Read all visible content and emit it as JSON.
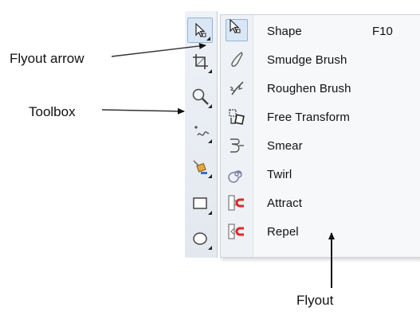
{
  "toolbox": {
    "tools": [
      {
        "icon": "shape-tool-icon",
        "selected": true
      },
      {
        "icon": "crop-tool-icon",
        "selected": false
      },
      {
        "icon": "zoom-tool-icon",
        "selected": false
      },
      {
        "icon": "freehand-tool-icon",
        "selected": false
      },
      {
        "icon": "smart-fill-tool-icon",
        "selected": false
      },
      {
        "icon": "rectangle-tool-icon",
        "selected": false
      },
      {
        "icon": "ellipse-tool-icon",
        "selected": false
      }
    ]
  },
  "flyout": {
    "items": [
      {
        "label": "Shape",
        "shortcut": "F10",
        "icon": "shape-tool-icon",
        "selected": true
      },
      {
        "label": "Smudge Brush",
        "icon": "smudge-brush-icon"
      },
      {
        "label": "Roughen Brush",
        "icon": "roughen-brush-icon"
      },
      {
        "label": "Free Transform",
        "icon": "free-transform-icon"
      },
      {
        "label": "Smear",
        "icon": "smear-icon"
      },
      {
        "label": "Twirl",
        "icon": "twirl-icon"
      },
      {
        "label": "Attract",
        "icon": "attract-icon"
      },
      {
        "label": "Repel",
        "icon": "repel-icon"
      }
    ]
  },
  "annotations": {
    "flyout_arrow": "Flyout arrow",
    "toolbox": "Toolbox",
    "flyout": "Flyout"
  },
  "colors": {
    "selection_fill": "#d9e6f5",
    "selection_border": "#93b3d6",
    "magnet_red": "#e0262b"
  }
}
